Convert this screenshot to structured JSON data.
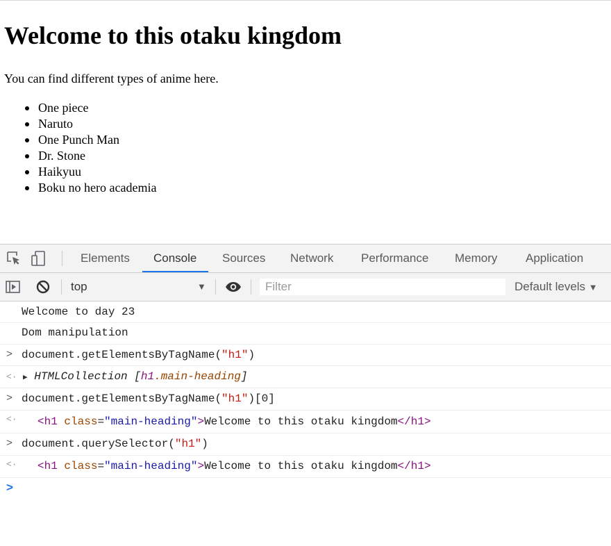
{
  "page": {
    "heading": "Welcome to this otaku kingdom",
    "paragraph": "You can find different types of anime here.",
    "anime_list": [
      "One piece",
      "Naruto",
      "One Punch Man",
      "Dr. Stone",
      "Haikyuu",
      "Boku no hero academia"
    ]
  },
  "devtools": {
    "tabs": [
      "Elements",
      "Console",
      "Sources",
      "Network",
      "Performance",
      "Memory",
      "Application"
    ],
    "active_tab": "Console",
    "toolbar": {
      "context": "top",
      "filter_placeholder": "Filter",
      "levels": "Default levels"
    },
    "console": {
      "logs": [
        "Welcome to day 23",
        "Dom manipulation"
      ],
      "cmd1": {
        "prefix": "document.getElementsByTagName(",
        "arg": "\"h1\"",
        "suffix": ")"
      },
      "res1": {
        "type": "HTMLCollection",
        "open": "[",
        "tag": "h1",
        "cls": ".main-heading",
        "close": "]"
      },
      "cmd2": {
        "prefix": "document.getElementsByTagName(",
        "arg": "\"h1\"",
        "suffix": ")[0]"
      },
      "res2": {
        "open": "<h1",
        "attr": "class",
        "eq": "=",
        "val": "\"main-heading\"",
        "gt": ">",
        "text": "Welcome to this otaku kingdom",
        "close": "</h1>"
      },
      "cmd3": {
        "prefix": "document.querySelector(",
        "arg": "\"h1\"",
        "suffix": ")"
      },
      "res3": {
        "open": "<h1",
        "attr": "class",
        "eq": "=",
        "val": "\"main-heading\"",
        "gt": ">",
        "text": "Welcome to this otaku kingdom",
        "close": "</h1>"
      }
    }
  },
  "colors": {
    "accent": "#1a73e8",
    "string": "#c41a16",
    "tag": "#881280",
    "attr": "#994500",
    "attrValue": "#1a1aa6"
  },
  "icons": [
    "inspect-element-icon",
    "device-toolbar-icon",
    "sidebar-toggle-icon",
    "clear-console-icon",
    "eye-icon",
    "dropdown-arrow-icon",
    "expand-triangle-icon",
    "prompt-caret-icon"
  ]
}
